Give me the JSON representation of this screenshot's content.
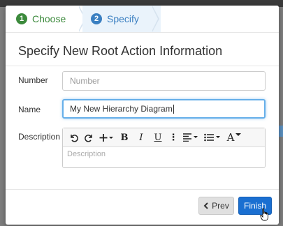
{
  "wizard": {
    "steps": [
      {
        "number": "1",
        "label": "Choose"
      },
      {
        "number": "2",
        "label": "Specify"
      }
    ]
  },
  "form": {
    "title": "Specify New Root Action Information",
    "number_label": "Number",
    "number_placeholder": "Number",
    "name_label": "Name",
    "name_value": "My New Hierarchy Diagram",
    "description_label": "Description",
    "description_placeholder": "Description"
  },
  "toolbar": {
    "bold": "B",
    "italic": "I",
    "underline": "U",
    "more": "⋮",
    "font": "A"
  },
  "footer": {
    "prev_label": "Prev",
    "finish_label": "Finish"
  },
  "colors": {
    "step1": "#3c8a3c",
    "step2": "#3a7fc1",
    "primary": "#1a6fd1"
  }
}
